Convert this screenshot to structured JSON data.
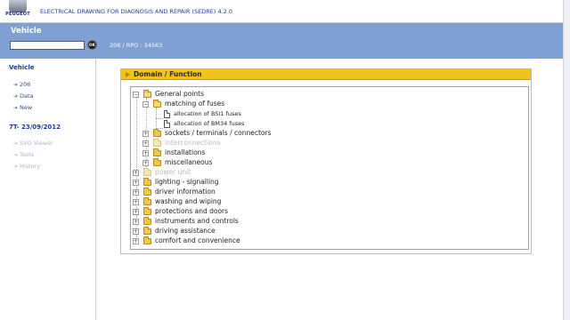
{
  "header": {
    "logo_text": "PEUGEOT",
    "title": "ELECTRICAL DRAWING FOR DIAGNOSIS AND REPAIR (SEDRE) 4.2.0"
  },
  "vehicle_bar": {
    "title": "Vehicle",
    "input_value": "",
    "ok_label": "OK",
    "info": "206  /  RPO : 34563"
  },
  "sidebar": {
    "section1_title": "Vehicle",
    "section1_links": [
      "206",
      "Data",
      "New"
    ],
    "section2_title": "7T- 23/09/2012",
    "section2_links": [
      "SVG Viewer",
      "Tools",
      "History"
    ]
  },
  "panel": {
    "title": "Domain  / Function"
  },
  "tree": {
    "general_points": "General points",
    "matching_of_fuses": "matching of fuses",
    "bsi1": "allocation of BSI1 fuses",
    "bm34": "allocation of BM34 fuses",
    "sockets": "sockets / terminals / connectors",
    "interconnections": "interconnections",
    "installations": "installations",
    "miscellaneous": "miscellaneous",
    "power_unit": "power unit",
    "lighting": "lighting - signalling",
    "driver_information": "driver information",
    "washing": "washing and wiping",
    "protections": "protections and doors",
    "instruments": "instruments and controls",
    "driving_assistance": "driving assistance",
    "comfort": "comfort and convenience"
  },
  "colors": {
    "vehicle_bar": "#7ea0d2",
    "panel_header": "#f2c31a",
    "link": "#35508f",
    "title_blue": "#1b3d8f"
  },
  "icons": [
    "peugeot-logo",
    "ok-icon",
    "arrow-icon",
    "folder-icon",
    "document-icon",
    "expand-icon",
    "collapse-icon"
  ]
}
